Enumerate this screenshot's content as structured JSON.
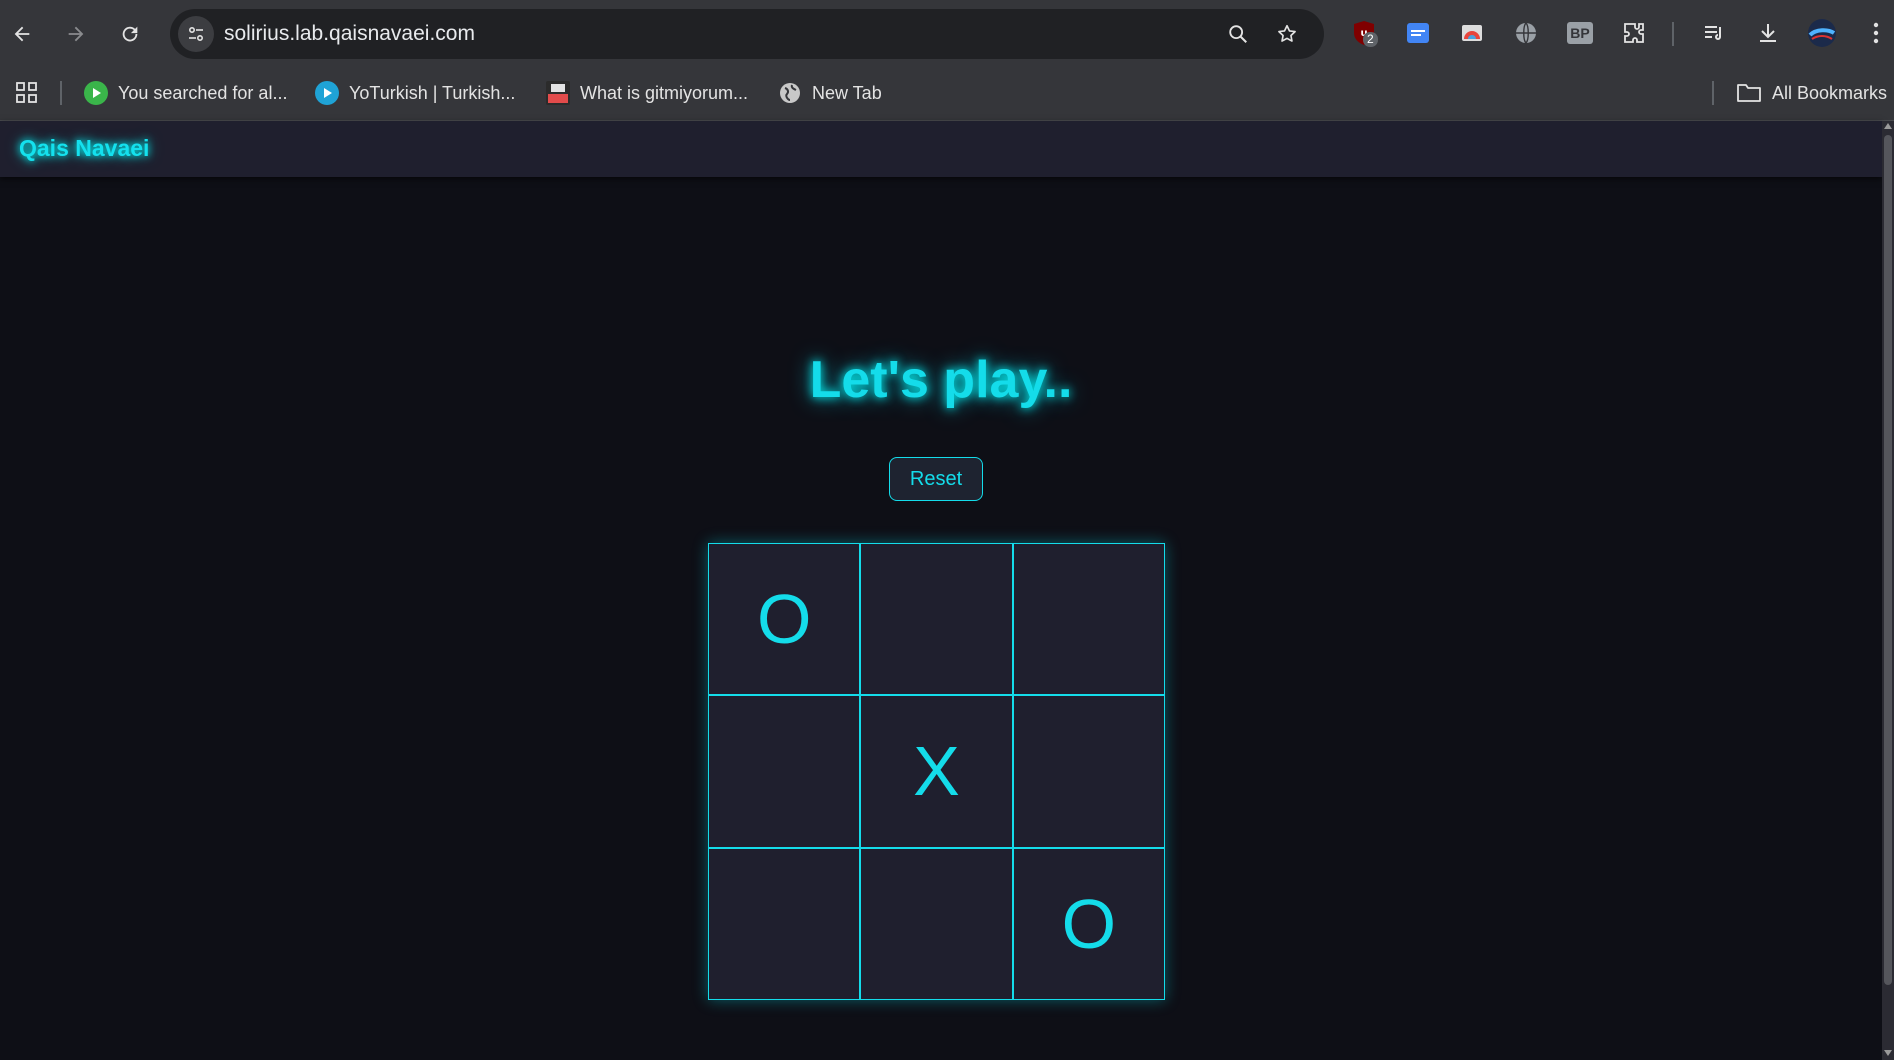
{
  "browser": {
    "url": "solirius.lab.qaisnavaei.com",
    "extension_badge": "2",
    "bp_label": "BP"
  },
  "bookmarks": {
    "items": [
      {
        "label": "You searched for al...",
        "icon": "play-green-icon",
        "color": "#3ab54a"
      },
      {
        "label": "YoTurkish | Turkish...",
        "icon": "play-blue-icon",
        "color": "#1fa3d6"
      },
      {
        "label": "What is gitmiyorum...",
        "icon": "seal-red-icon",
        "color": "#e24b4b"
      },
      {
        "label": "New Tab",
        "icon": "globe-icon",
        "color": "#c8c8c8"
      }
    ],
    "all_label": "All Bookmarks"
  },
  "site": {
    "brand": "Qais Navaei",
    "title": "Let's play..",
    "reset_label": "Reset"
  },
  "board": [
    "O",
    "",
    "",
    "",
    "X",
    "",
    "",
    "",
    "O"
  ],
  "colors": {
    "accent": "#14dcea",
    "background": "#0e0f16",
    "cell": "#1f1f2e"
  }
}
